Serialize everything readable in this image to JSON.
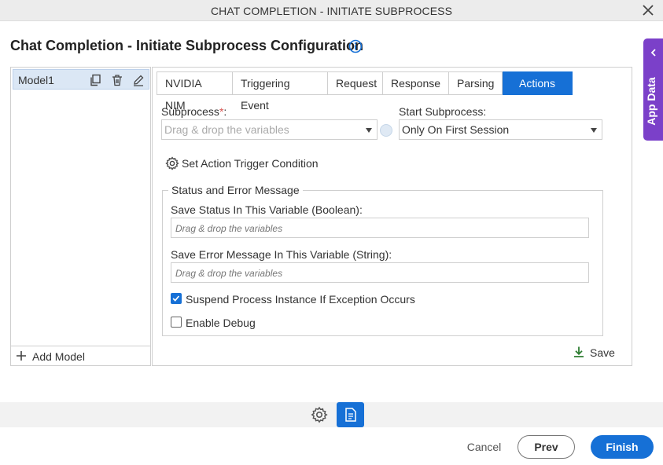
{
  "window": {
    "title": "CHAT COMPLETION - INITIATE SUBPROCESS"
  },
  "page": {
    "title": "Chat Completion - Initiate Subprocess Configuration"
  },
  "app_data_tab": {
    "label": "App Data"
  },
  "models": {
    "items": [
      {
        "name": "Model1"
      }
    ],
    "add_label": "Add Model"
  },
  "tabs": [
    {
      "label": "NVIDIA NIM",
      "active": false
    },
    {
      "label": "Triggering Event",
      "active": false
    },
    {
      "label": "Request",
      "active": false
    },
    {
      "label": "Response",
      "active": false
    },
    {
      "label": "Parsing",
      "active": false
    },
    {
      "label": "Actions",
      "active": true
    }
  ],
  "actions": {
    "subprocess": {
      "label": "Subprocess",
      "required_mark": "*",
      "label_suffix": ":",
      "placeholder": "Drag & drop the variables"
    },
    "start_subprocess": {
      "label": "Start Subprocess:",
      "value": "Only On First Session"
    },
    "trigger_condition_label": "Set Action Trigger Condition",
    "status_group": {
      "legend": "Status and Error Message",
      "status_var_label": "Save Status In This Variable (Boolean):",
      "status_var_placeholder": "Drag & drop the variables",
      "error_var_label": "Save Error Message In This Variable (String):",
      "error_var_placeholder": "Drag & drop the variables",
      "suspend_label": "Suspend Process Instance If Exception Occurs",
      "suspend_checked": true,
      "debug_label": "Enable Debug",
      "debug_checked": false
    },
    "save_label": "Save"
  },
  "footer": {
    "cancel": "Cancel",
    "prev": "Prev",
    "finish": "Finish"
  },
  "colors": {
    "accent": "#1670d6",
    "app_data": "#7b40c9",
    "required": "#d9534f",
    "save_icon": "#2e7d32"
  }
}
